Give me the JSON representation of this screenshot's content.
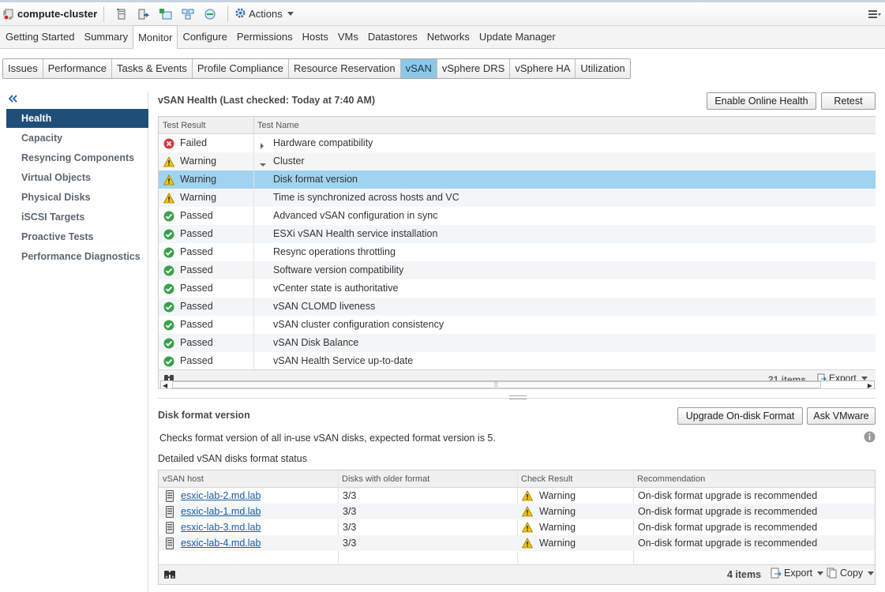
{
  "header": {
    "title": "compute-cluster",
    "actions_label": "Actions"
  },
  "main_tabs": [
    {
      "label": "Getting Started"
    },
    {
      "label": "Summary"
    },
    {
      "label": "Monitor"
    },
    {
      "label": "Configure"
    },
    {
      "label": "Permissions"
    },
    {
      "label": "Hosts"
    },
    {
      "label": "VMs"
    },
    {
      "label": "Datastores"
    },
    {
      "label": "Networks"
    },
    {
      "label": "Update Manager"
    }
  ],
  "active_main_tab": "Monitor",
  "sub_tabs": [
    {
      "label": "Issues"
    },
    {
      "label": "Performance"
    },
    {
      "label": "Tasks & Events"
    },
    {
      "label": "Profile Compliance"
    },
    {
      "label": "Resource Reservation"
    },
    {
      "label": "vSAN"
    },
    {
      "label": "vSphere DRS"
    },
    {
      "label": "vSphere HA"
    },
    {
      "label": "Utilization"
    }
  ],
  "active_sub_tab": "vSAN",
  "sidebar": {
    "items": [
      {
        "label": "Health"
      },
      {
        "label": "Capacity"
      },
      {
        "label": "Resyncing Components"
      },
      {
        "label": "Virtual Objects"
      },
      {
        "label": "Physical Disks"
      },
      {
        "label": "iSCSI Targets"
      },
      {
        "label": "Proactive Tests"
      },
      {
        "label": "Performance Diagnostics"
      }
    ],
    "active": "Health"
  },
  "health": {
    "title": "vSAN Health (Last checked: Today at 7:40 AM)",
    "enable_online_health_label": "Enable Online Health",
    "retest_label": "Retest",
    "columns": {
      "result": "Test Result",
      "name": "Test Name"
    },
    "rows": [
      {
        "result": "Failed",
        "status": "failed",
        "name": "Hardware compatibility",
        "tree": "collapsed"
      },
      {
        "result": "Warning",
        "status": "warning",
        "name": "Cluster",
        "tree": "expanded"
      },
      {
        "result": "Warning",
        "status": "warning",
        "name": "Disk format version",
        "selected": true
      },
      {
        "result": "Warning",
        "status": "warning",
        "name": "Time is synchronized across hosts and VC"
      },
      {
        "result": "Passed",
        "status": "passed",
        "name": "Advanced vSAN configuration in sync"
      },
      {
        "result": "Passed",
        "status": "passed",
        "name": "ESXi vSAN Health service installation"
      },
      {
        "result": "Passed",
        "status": "passed",
        "name": "Resync operations throttling"
      },
      {
        "result": "Passed",
        "status": "passed",
        "name": "Software version compatibility"
      },
      {
        "result": "Passed",
        "status": "passed",
        "name": "vCenter state is authoritative"
      },
      {
        "result": "Passed",
        "status": "passed",
        "name": "vSAN CLOMD liveness"
      },
      {
        "result": "Passed",
        "status": "passed",
        "name": "vSAN cluster configuration consistency"
      },
      {
        "result": "Passed",
        "status": "passed",
        "name": "vSAN Disk Balance"
      },
      {
        "result": "Passed",
        "status": "passed",
        "name": "vSAN Health Service up-to-date"
      }
    ],
    "items_count": "21 items",
    "export_label": "Export"
  },
  "detail": {
    "title": "Disk format version",
    "upgrade_label": "Upgrade On-disk Format",
    "ask_vmware_label": "Ask VMware",
    "description": "Checks format version of all in-use vSAN disks, expected format version is 5.",
    "subtitle": "Detailed vSAN disks format status",
    "columns": {
      "host": "vSAN host",
      "disks": "Disks with older format",
      "check": "Check Result",
      "recommendation": "Recommendation"
    },
    "rows": [
      {
        "host": "esxic-lab-2.md.lab",
        "disks": "3/3",
        "check": "Warning",
        "recommendation": "On-disk format upgrade is recommended"
      },
      {
        "host": "esxic-lab-1.md.lab",
        "disks": "3/3",
        "check": "Warning",
        "recommendation": "On-disk format upgrade is recommended"
      },
      {
        "host": "esxic-lab-3.md.lab",
        "disks": "3/3",
        "check": "Warning",
        "recommendation": "On-disk format upgrade is recommended"
      },
      {
        "host": "esxic-lab-4.md.lab",
        "disks": "3/3",
        "check": "Warning",
        "recommendation": "On-disk format upgrade is recommended"
      }
    ],
    "items_count": "4 items",
    "export_label": "Export",
    "copy_label": "Copy"
  },
  "colors": {
    "accent": "#1f4e79",
    "selected_row": "#9fd3f1",
    "active_subtab": "#8ec7e6",
    "passed": "#3aa04a",
    "warning": "#f2c40f",
    "failed": "#d9363e",
    "link": "#1a5aa0"
  }
}
